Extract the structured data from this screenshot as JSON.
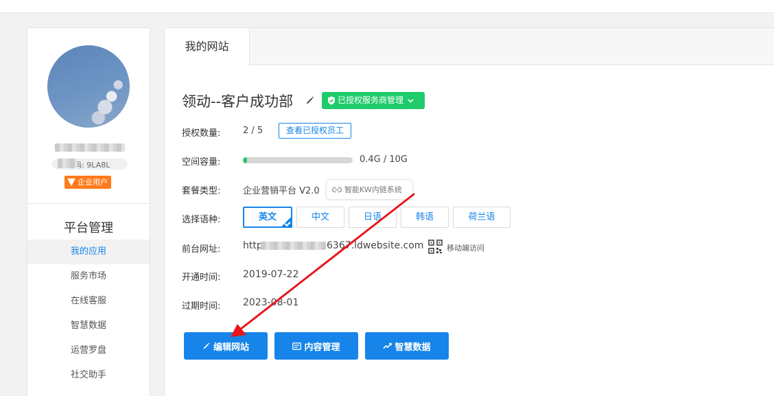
{
  "profile": {
    "pin_label": "PIN码: 9LA8L",
    "user_type": "企业用户"
  },
  "sidebar": {
    "title": "平台管理",
    "items": [
      {
        "label": "我的应用",
        "active": true
      },
      {
        "label": "服务市场"
      },
      {
        "label": "在线客服"
      },
      {
        "label": "智慧数据"
      },
      {
        "label": "运营罗盘"
      },
      {
        "label": "社交助手"
      }
    ]
  },
  "main": {
    "tab_label": "我的网站",
    "site_name": "领动--客户成功部",
    "auth_badge": "已授权服务商管理",
    "rows": {
      "auth_count_label": "授权数量:",
      "auth_count_value": "2 / 5",
      "view_staff_button": "查看已授权员工",
      "storage_label": "空间容量:",
      "storage_used_fraction": 0.04,
      "storage_text": "0.4G / 10G",
      "plan_label": "套餐类型:",
      "plan_value": "企业营销平台 V2.0",
      "kw_chip": "智能KW内链系统",
      "language_label": "选择语种:",
      "languages": [
        "英文",
        "中文",
        "日语",
        "韩语",
        "荷兰语"
      ],
      "selected_language": "英文",
      "frontend_url_label": "前台网址:",
      "frontend_url_prefix": "http",
      "frontend_url_suffix": "6367.ldwebsite.com",
      "mobile_access": "移动端访问",
      "open_date_label": "开通时间:",
      "open_date": "2019-07-22",
      "expire_date_label": "过期时间:",
      "expire_date": "2023-08-01"
    },
    "actions": {
      "edit_site": "编辑网站",
      "content_management": "内容管理",
      "smart_data": "智慧数据"
    }
  },
  "colors": {
    "primary": "#1684e8",
    "success": "#1fcb6a",
    "enterprise": "#ff7a1a",
    "annotation_arrow": "#e8161b"
  }
}
